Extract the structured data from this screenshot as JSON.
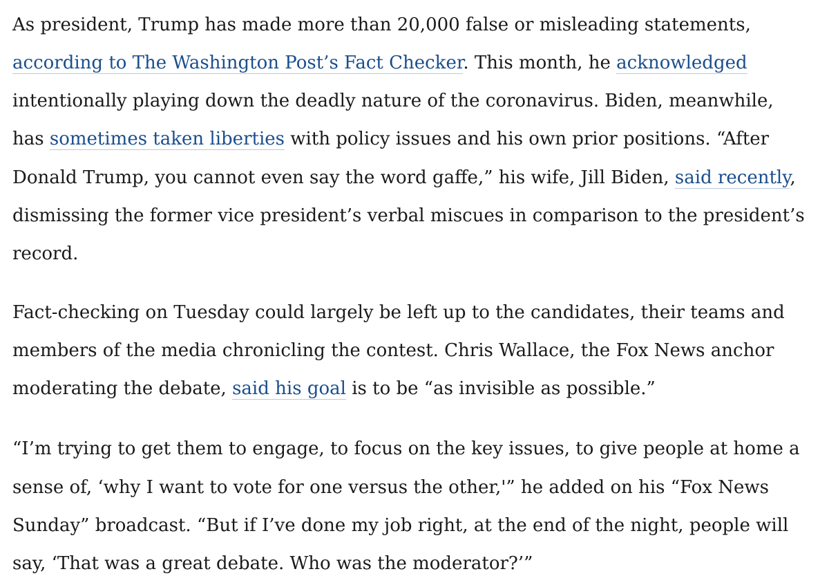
{
  "article": {
    "paragraphs": [
      {
        "lines": [
          [
            {
              "text": "As president, Trump has made more than 20,000 false or misleading statements,"
            }
          ],
          [
            {
              "text": "according to The Washington Post’s Fact Checker",
              "link": true
            },
            {
              "text": ". This month, he "
            },
            {
              "text": "acknowledged",
              "link": true
            }
          ],
          [
            {
              "text": "intentionally playing down the deadly nature of the coronavirus. Biden, meanwhile,"
            }
          ],
          [
            {
              "text": "has "
            },
            {
              "text": "sometimes taken liberties",
              "link": true
            },
            {
              "text": " with policy issues and his own prior positions. “After"
            }
          ],
          [
            {
              "text": "Donald Trump, you cannot even say the word gaffe,” his wife, Jill Biden, "
            },
            {
              "text": "said recently",
              "link": true
            },
            {
              "text": ","
            }
          ],
          [
            {
              "text": "dismissing the former vice president’s verbal miscues in comparison to the president’s"
            }
          ],
          [
            {
              "text": "record."
            }
          ]
        ]
      },
      {
        "lines": [
          [
            {
              "text": "Fact-checking on Tuesday could largely be left up to the candidates, their teams and"
            }
          ],
          [
            {
              "text": "members of the media chronicling the contest. Chris Wallace, the Fox News anchor"
            }
          ],
          [
            {
              "text": "moderating the debate, "
            },
            {
              "text": "said his goal",
              "link": true
            },
            {
              "text": " is to be “as invisible as possible.”"
            }
          ]
        ]
      },
      {
        "lines": [
          [
            {
              "text": "“I’m trying to get them to engage, to focus on the key issues, to give people at home a"
            }
          ],
          [
            {
              "text": "sense of, ‘why I want to vote for one versus the other,'” he added on his “Fox News"
            }
          ],
          [
            {
              "text": "Sunday” broadcast. “But if I’ve done my job right, at the end of the night, people will"
            }
          ],
          [
            {
              "text": "say, ‘That was a great debate. Who was the moderator?’”"
            }
          ]
        ]
      }
    ]
  },
  "colors": {
    "text": "#1a1a1a",
    "link": "#1a4e8c",
    "link_underline": "#b9c8de",
    "background": "#ffffff"
  }
}
